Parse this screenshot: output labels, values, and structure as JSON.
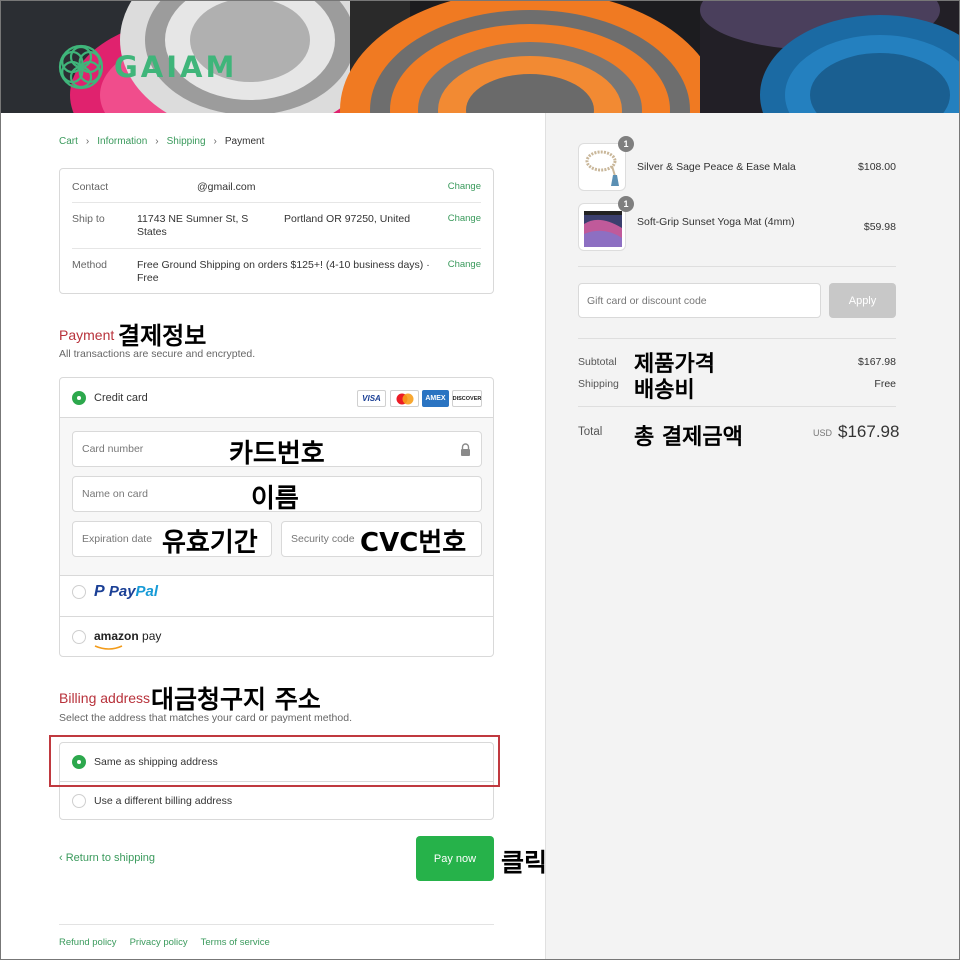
{
  "brand": {
    "name": "GAIAM"
  },
  "breadcrumb": {
    "cart": "Cart",
    "information": "Information",
    "shipping": "Shipping",
    "payment": "Payment"
  },
  "info": {
    "contact_label": "Contact",
    "contact_value": "@gmail.com",
    "contact_change": "Change",
    "ship_label": "Ship to",
    "ship_line1": "11743 NE Sumner St, S",
    "ship_line2": "States",
    "ship_city": "Portland OR 97250, United",
    "ship_change": "Change",
    "method_label": "Method",
    "method_line1": "Free Ground Shipping on orders $125+! (4-10 business days) ·",
    "method_line2": "Free",
    "method_change": "Change"
  },
  "payment": {
    "title": "Payment",
    "note": "결제정보",
    "subtitle": "All transactions are secure and encrypted.",
    "credit_card_label": "Credit card",
    "badges": [
      "VISA",
      "",
      "AMEX",
      "DISCOVER"
    ],
    "card_number_ph": "Card number",
    "card_number_note": "카드번호",
    "name_ph": "Name on card",
    "name_note": "이름",
    "exp_ph": "Expiration date",
    "exp_note": "유효기간",
    "cvc_ph": "Security code",
    "cvc_note": "CVC번호",
    "paypal_a": "Pay",
    "paypal_b": "Pal",
    "amazon_a": "amazon",
    "amazon_b": " pay"
  },
  "billing": {
    "title": "Billing address",
    "note": "대금청구지 주소",
    "subtitle": "Select the address that matches your card or payment method.",
    "same_label": "Same as shipping address",
    "different_label": "Use a different billing address"
  },
  "actions": {
    "return_label": "‹ Return to shipping",
    "pay_label": "Pay now",
    "pay_note": "클릭"
  },
  "footer": {
    "refund": "Refund policy",
    "privacy": "Privacy policy",
    "terms": "Terms of service"
  },
  "summary": {
    "products": [
      {
        "name": "Silver & Sage Peace & Ease Mala",
        "price": "$108.00",
        "qty": "1"
      },
      {
        "name": "Soft-Grip Sunset Yoga Mat (4mm)",
        "price": "$59.98",
        "qty": "1"
      }
    ],
    "gift_ph": "Gift card or discount code",
    "apply_label": "Apply",
    "subtotal_label": "Subtotal",
    "subtotal_note": "제품가격",
    "subtotal_value": "$167.98",
    "shipping_label": "Shipping",
    "shipping_note": "배송비",
    "shipping_value": "Free",
    "total_label": "Total",
    "total_note": "총 결제금액",
    "currency": "USD",
    "total_value": "$167.98"
  },
  "colors": {
    "accent_green": "#3a9a5c",
    "pay_button": "#26b24a",
    "section_red": "#b8323b",
    "highlight_red": "#c0393f"
  }
}
